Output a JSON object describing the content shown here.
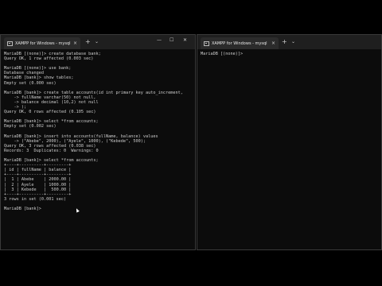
{
  "left_window": {
    "tab_title": "XAMPP for Windows - mysql",
    "tab_close": "×",
    "new_tab": "+",
    "dropdown": "⌄",
    "minimize": "—",
    "maximize": "☐",
    "close": "✕",
    "lines": [
      "MariaDB [(none)]> create database bank;",
      "Query OK, 1 row affected (0.003 sec)",
      "",
      "MariaDB [(none)]> use bank;",
      "Database changed",
      "MariaDB [bank]> show tables;",
      "Empty set (0.000 sec)",
      "",
      "MariaDB [bank]> create table accounts(id int primary key auto_increment,",
      "    -> fullName varchar(50) not null,",
      "    -> balance decimal (10,2) not null",
      "    -> );",
      "Query OK, 0 rows affected (0.105 sec)",
      "",
      "MariaDB [bank]> select *from accounts;",
      "Empty set (0.002 sec)",
      "",
      "MariaDB [bank]> insert into accounts(fullName, balance) values",
      "    -> (\"Abebe\", 2000), (\"Ayele\", 1000), (\"Kebede\", 500);",
      "Query OK, 3 rows affected (0.038 sec)",
      "Records: 3  Duplicates: 0  Warnings: 0",
      "",
      "MariaDB [bank]> select *from accounts;",
      "+----+----------+---------+",
      "| id | fullName | balance |",
      "+----+----------+---------+",
      "|  1 | Abebe    | 2000.00 |",
      "|  2 | Ayele    | 1000.00 |",
      "|  3 | Kebede   |  500.00 |",
      "+----+----------+---------+",
      "3 rows in set (0.001 sec)",
      "",
      "MariaDB [bank]>"
    ]
  },
  "right_window": {
    "tab_title": "XAMPP for Windows - mysql",
    "tab_close": "×",
    "new_tab": "+",
    "dropdown": "⌄",
    "lines": [
      "MariaDB [(none)]>"
    ]
  }
}
